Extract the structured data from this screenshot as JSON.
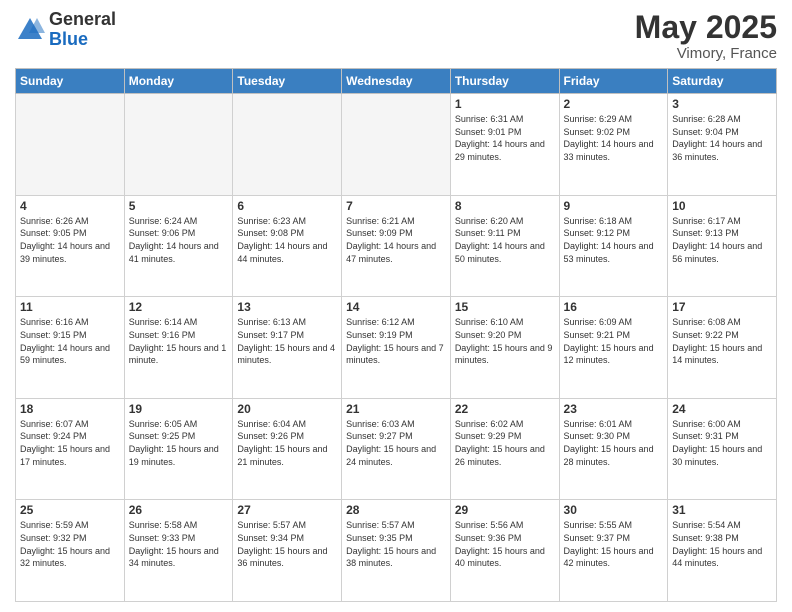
{
  "header": {
    "logo_general": "General",
    "logo_blue": "Blue",
    "month_year": "May 2025",
    "location": "Vimory, France"
  },
  "days_of_week": [
    "Sunday",
    "Monday",
    "Tuesday",
    "Wednesday",
    "Thursday",
    "Friday",
    "Saturday"
  ],
  "weeks": [
    [
      {
        "day": "",
        "info": ""
      },
      {
        "day": "",
        "info": ""
      },
      {
        "day": "",
        "info": ""
      },
      {
        "day": "",
        "info": ""
      },
      {
        "day": "1",
        "info": "Sunrise: 6:31 AM\nSunset: 9:01 PM\nDaylight: 14 hours\nand 29 minutes."
      },
      {
        "day": "2",
        "info": "Sunrise: 6:29 AM\nSunset: 9:02 PM\nDaylight: 14 hours\nand 33 minutes."
      },
      {
        "day": "3",
        "info": "Sunrise: 6:28 AM\nSunset: 9:04 PM\nDaylight: 14 hours\nand 36 minutes."
      }
    ],
    [
      {
        "day": "4",
        "info": "Sunrise: 6:26 AM\nSunset: 9:05 PM\nDaylight: 14 hours\nand 39 minutes."
      },
      {
        "day": "5",
        "info": "Sunrise: 6:24 AM\nSunset: 9:06 PM\nDaylight: 14 hours\nand 41 minutes."
      },
      {
        "day": "6",
        "info": "Sunrise: 6:23 AM\nSunset: 9:08 PM\nDaylight: 14 hours\nand 44 minutes."
      },
      {
        "day": "7",
        "info": "Sunrise: 6:21 AM\nSunset: 9:09 PM\nDaylight: 14 hours\nand 47 minutes."
      },
      {
        "day": "8",
        "info": "Sunrise: 6:20 AM\nSunset: 9:11 PM\nDaylight: 14 hours\nand 50 minutes."
      },
      {
        "day": "9",
        "info": "Sunrise: 6:18 AM\nSunset: 9:12 PM\nDaylight: 14 hours\nand 53 minutes."
      },
      {
        "day": "10",
        "info": "Sunrise: 6:17 AM\nSunset: 9:13 PM\nDaylight: 14 hours\nand 56 minutes."
      }
    ],
    [
      {
        "day": "11",
        "info": "Sunrise: 6:16 AM\nSunset: 9:15 PM\nDaylight: 14 hours\nand 59 minutes."
      },
      {
        "day": "12",
        "info": "Sunrise: 6:14 AM\nSunset: 9:16 PM\nDaylight: 15 hours\nand 1 minute."
      },
      {
        "day": "13",
        "info": "Sunrise: 6:13 AM\nSunset: 9:17 PM\nDaylight: 15 hours\nand 4 minutes."
      },
      {
        "day": "14",
        "info": "Sunrise: 6:12 AM\nSunset: 9:19 PM\nDaylight: 15 hours\nand 7 minutes."
      },
      {
        "day": "15",
        "info": "Sunrise: 6:10 AM\nSunset: 9:20 PM\nDaylight: 15 hours\nand 9 minutes."
      },
      {
        "day": "16",
        "info": "Sunrise: 6:09 AM\nSunset: 9:21 PM\nDaylight: 15 hours\nand 12 minutes."
      },
      {
        "day": "17",
        "info": "Sunrise: 6:08 AM\nSunset: 9:22 PM\nDaylight: 15 hours\nand 14 minutes."
      }
    ],
    [
      {
        "day": "18",
        "info": "Sunrise: 6:07 AM\nSunset: 9:24 PM\nDaylight: 15 hours\nand 17 minutes."
      },
      {
        "day": "19",
        "info": "Sunrise: 6:05 AM\nSunset: 9:25 PM\nDaylight: 15 hours\nand 19 minutes."
      },
      {
        "day": "20",
        "info": "Sunrise: 6:04 AM\nSunset: 9:26 PM\nDaylight: 15 hours\nand 21 minutes."
      },
      {
        "day": "21",
        "info": "Sunrise: 6:03 AM\nSunset: 9:27 PM\nDaylight: 15 hours\nand 24 minutes."
      },
      {
        "day": "22",
        "info": "Sunrise: 6:02 AM\nSunset: 9:29 PM\nDaylight: 15 hours\nand 26 minutes."
      },
      {
        "day": "23",
        "info": "Sunrise: 6:01 AM\nSunset: 9:30 PM\nDaylight: 15 hours\nand 28 minutes."
      },
      {
        "day": "24",
        "info": "Sunrise: 6:00 AM\nSunset: 9:31 PM\nDaylight: 15 hours\nand 30 minutes."
      }
    ],
    [
      {
        "day": "25",
        "info": "Sunrise: 5:59 AM\nSunset: 9:32 PM\nDaylight: 15 hours\nand 32 minutes."
      },
      {
        "day": "26",
        "info": "Sunrise: 5:58 AM\nSunset: 9:33 PM\nDaylight: 15 hours\nand 34 minutes."
      },
      {
        "day": "27",
        "info": "Sunrise: 5:57 AM\nSunset: 9:34 PM\nDaylight: 15 hours\nand 36 minutes."
      },
      {
        "day": "28",
        "info": "Sunrise: 5:57 AM\nSunset: 9:35 PM\nDaylight: 15 hours\nand 38 minutes."
      },
      {
        "day": "29",
        "info": "Sunrise: 5:56 AM\nSunset: 9:36 PM\nDaylight: 15 hours\nand 40 minutes."
      },
      {
        "day": "30",
        "info": "Sunrise: 5:55 AM\nSunset: 9:37 PM\nDaylight: 15 hours\nand 42 minutes."
      },
      {
        "day": "31",
        "info": "Sunrise: 5:54 AM\nSunset: 9:38 PM\nDaylight: 15 hours\nand 44 minutes."
      }
    ]
  ]
}
